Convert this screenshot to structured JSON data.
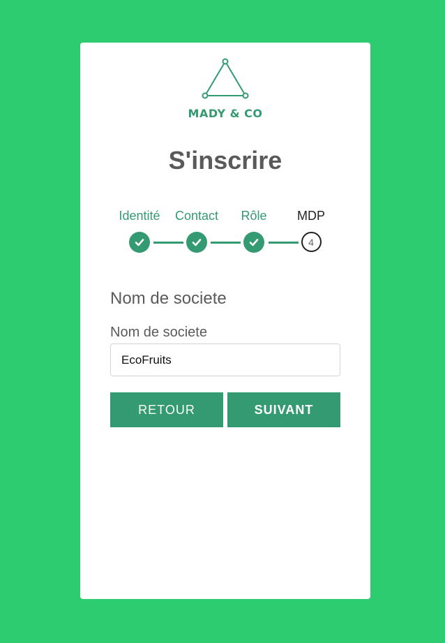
{
  "brand": {
    "name": "MADY & CO",
    "logo_icon": "triangle-logo-icon",
    "color": "#349a72"
  },
  "page": {
    "title": "S'inscrire",
    "background_color": "#2ecc71"
  },
  "stepper": {
    "steps": [
      {
        "label": "Identité",
        "status": "completed",
        "icon": "check-icon"
      },
      {
        "label": "Contact",
        "status": "completed",
        "icon": "check-icon"
      },
      {
        "label": "Rôle",
        "status": "completed",
        "icon": "check-icon"
      },
      {
        "label": "MDP",
        "status": "current",
        "number": "4"
      }
    ]
  },
  "form": {
    "section_heading": "Nom de societe",
    "company_field": {
      "label": "Nom de societe",
      "value": "EcoFruits"
    }
  },
  "buttons": {
    "back_label": "Retour",
    "next_label": "Suivant"
  }
}
